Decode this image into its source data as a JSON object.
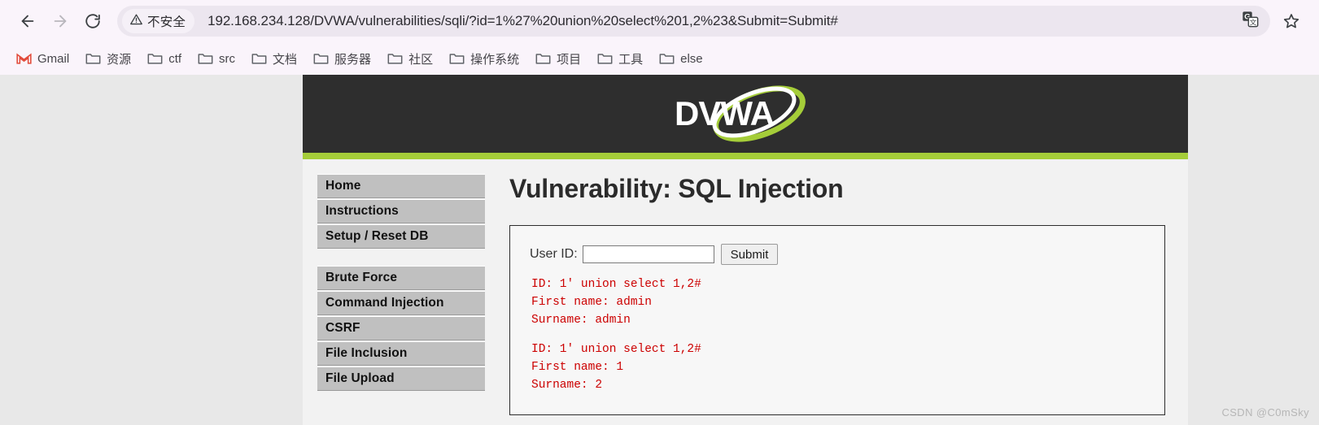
{
  "browser": {
    "back_label": "back-arrow",
    "forward_label": "forward-arrow",
    "reload_label": "reload",
    "security_status": "不安全",
    "url": "192.168.234.128/DVWA/vulnerabilities/sqli/?id=1%27%20union%20select%201,2%23&Submit=Submit#",
    "url_placeholder": "搜索或输入网址",
    "translate_icon": "translate-icon",
    "bookmark_star_icon": "star-icon",
    "bookmarks": [
      {
        "label": "Gmail",
        "icon": "gmail-icon"
      },
      {
        "label": "资源",
        "icon": "folder-icon"
      },
      {
        "label": "ctf",
        "icon": "folder-icon"
      },
      {
        "label": "src",
        "icon": "folder-icon"
      },
      {
        "label": "文档",
        "icon": "folder-icon"
      },
      {
        "label": "服务器",
        "icon": "folder-icon"
      },
      {
        "label": "社区",
        "icon": "folder-icon"
      },
      {
        "label": "操作系统",
        "icon": "folder-icon"
      },
      {
        "label": "项目",
        "icon": "folder-icon"
      },
      {
        "label": "工具",
        "icon": "folder-icon"
      },
      {
        "label": "else",
        "icon": "folder-icon"
      }
    ]
  },
  "page": {
    "logo_text": "DVWA",
    "title": "Vulnerability: SQL Injection",
    "sidebar": {
      "group1": [
        {
          "label": "Home"
        },
        {
          "label": "Instructions"
        },
        {
          "label": "Setup / Reset DB"
        }
      ],
      "group2": [
        {
          "label": "Brute Force"
        },
        {
          "label": "Command Injection"
        },
        {
          "label": "CSRF"
        },
        {
          "label": "File Inclusion"
        },
        {
          "label": "File Upload"
        }
      ]
    },
    "form": {
      "label": "User ID:",
      "input_value": "",
      "input_placeholder": "",
      "submit_label": "Submit"
    },
    "results": [
      {
        "id_line": "ID: 1' union select 1,2#",
        "first_name_line": "First name: admin",
        "surname_line": "Surname: admin"
      },
      {
        "id_line": "ID: 1' union select 1,2#",
        "first_name_line": "First name: 1",
        "surname_line": "Surname: 2"
      }
    ]
  },
  "watermark": "CSDN @C0mSky",
  "colors": {
    "header_dark": "#2e2e2e",
    "accent_green": "#a5cd39",
    "result_red": "#cc0000",
    "menu_gray": "#c0c0c0"
  }
}
